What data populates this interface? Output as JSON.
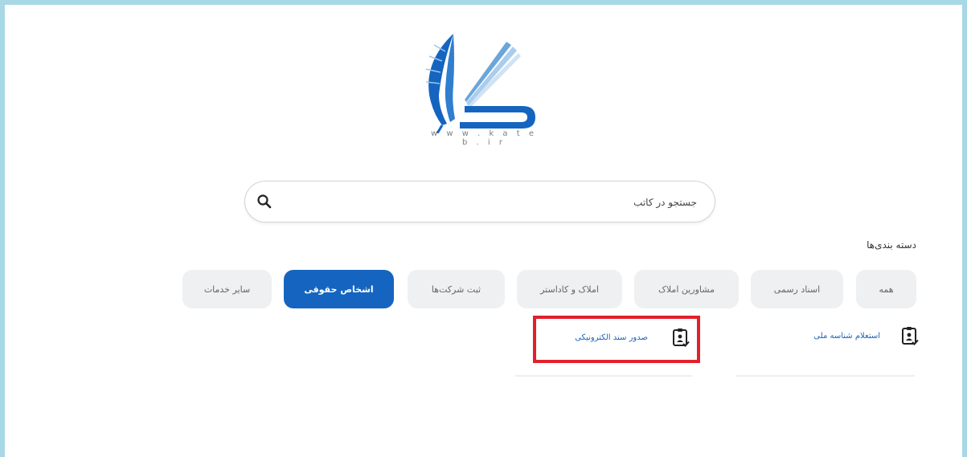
{
  "logo": {
    "icon": "kateb-feather-book-logo",
    "url_text": "w w w . k a t e b . i r"
  },
  "search": {
    "placeholder": "جستجو در کاتب",
    "icon": "search-icon"
  },
  "categories": {
    "title": "دسته بندی‌ها",
    "items": [
      {
        "label": "همه",
        "active": false
      },
      {
        "label": "اسناد رسمی",
        "active": false
      },
      {
        "label": "مشاورین املاک",
        "active": false
      },
      {
        "label": "املاک و کاداستر",
        "active": false
      },
      {
        "label": "ثبت شرکت‌ها",
        "active": false
      },
      {
        "label": "اشخاص حقوقی",
        "active": true
      },
      {
        "label": "سایر خدمات",
        "active": false
      }
    ]
  },
  "services": [
    {
      "label": "استعلام شناسه ملی",
      "icon": "document-check-icon"
    },
    {
      "label": "صدور سند الکترونیکی",
      "icon": "document-check-icon",
      "highlighted": true
    }
  ],
  "colors": {
    "accent": "#1565c0",
    "highlight": "#e2202b",
    "frame": "#a8d8e6",
    "chip_bg": "#eef0f2"
  }
}
